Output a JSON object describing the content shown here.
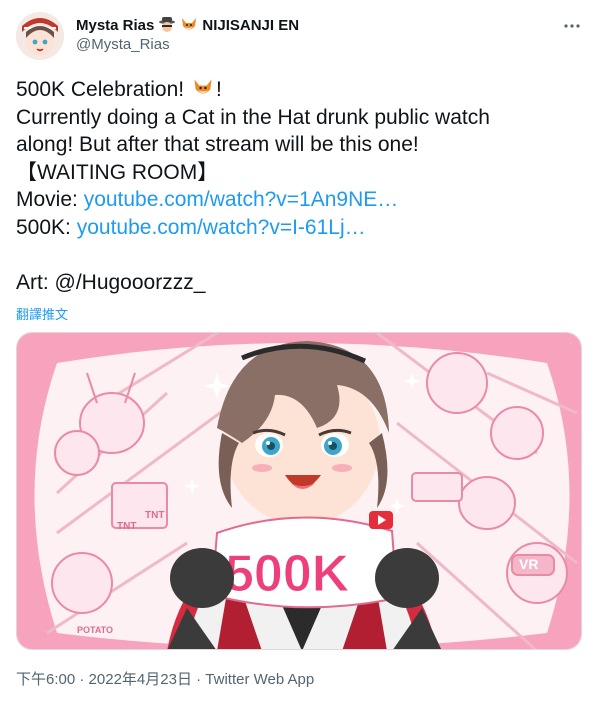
{
  "author": {
    "display_name": "Mysta Rias",
    "org": "NIJISANJI EN",
    "handle": "@Mysta_Rias",
    "badge_icons": [
      "detective-emoji",
      "fox-emoji"
    ]
  },
  "tweet": {
    "lines": [
      "500K Celebration! ",
      "!",
      "Currently doing a Cat in the Hat drunk public watch",
      "along! But after that stream will be this one!",
      "【WAITING ROOM】"
    ],
    "movie_label": "Movie: ",
    "movie_link": "youtube.com/watch?v=1An9NE…",
    "k_label": "500K: ",
    "k_link": "youtube.com/watch?v=I-61Lj…",
    "art_label": "Art: @/Hugooorzzz_"
  },
  "translate_label": "翻譯推文",
  "media": {
    "logo_text": "500K",
    "tag_tnt": "TNT",
    "tag_vr": "VR",
    "tag_potato": "POTATO"
  },
  "meta": {
    "time": "下午6:00",
    "sep1": " · ",
    "date": "2022年4月23日",
    "sep2": " · ",
    "app": "Twitter Web App"
  },
  "colors": {
    "link": "#1d9bf0",
    "secondary": "#536471",
    "accent_pink": "#f27ba1",
    "jacket_red": "#d62b3f"
  }
}
